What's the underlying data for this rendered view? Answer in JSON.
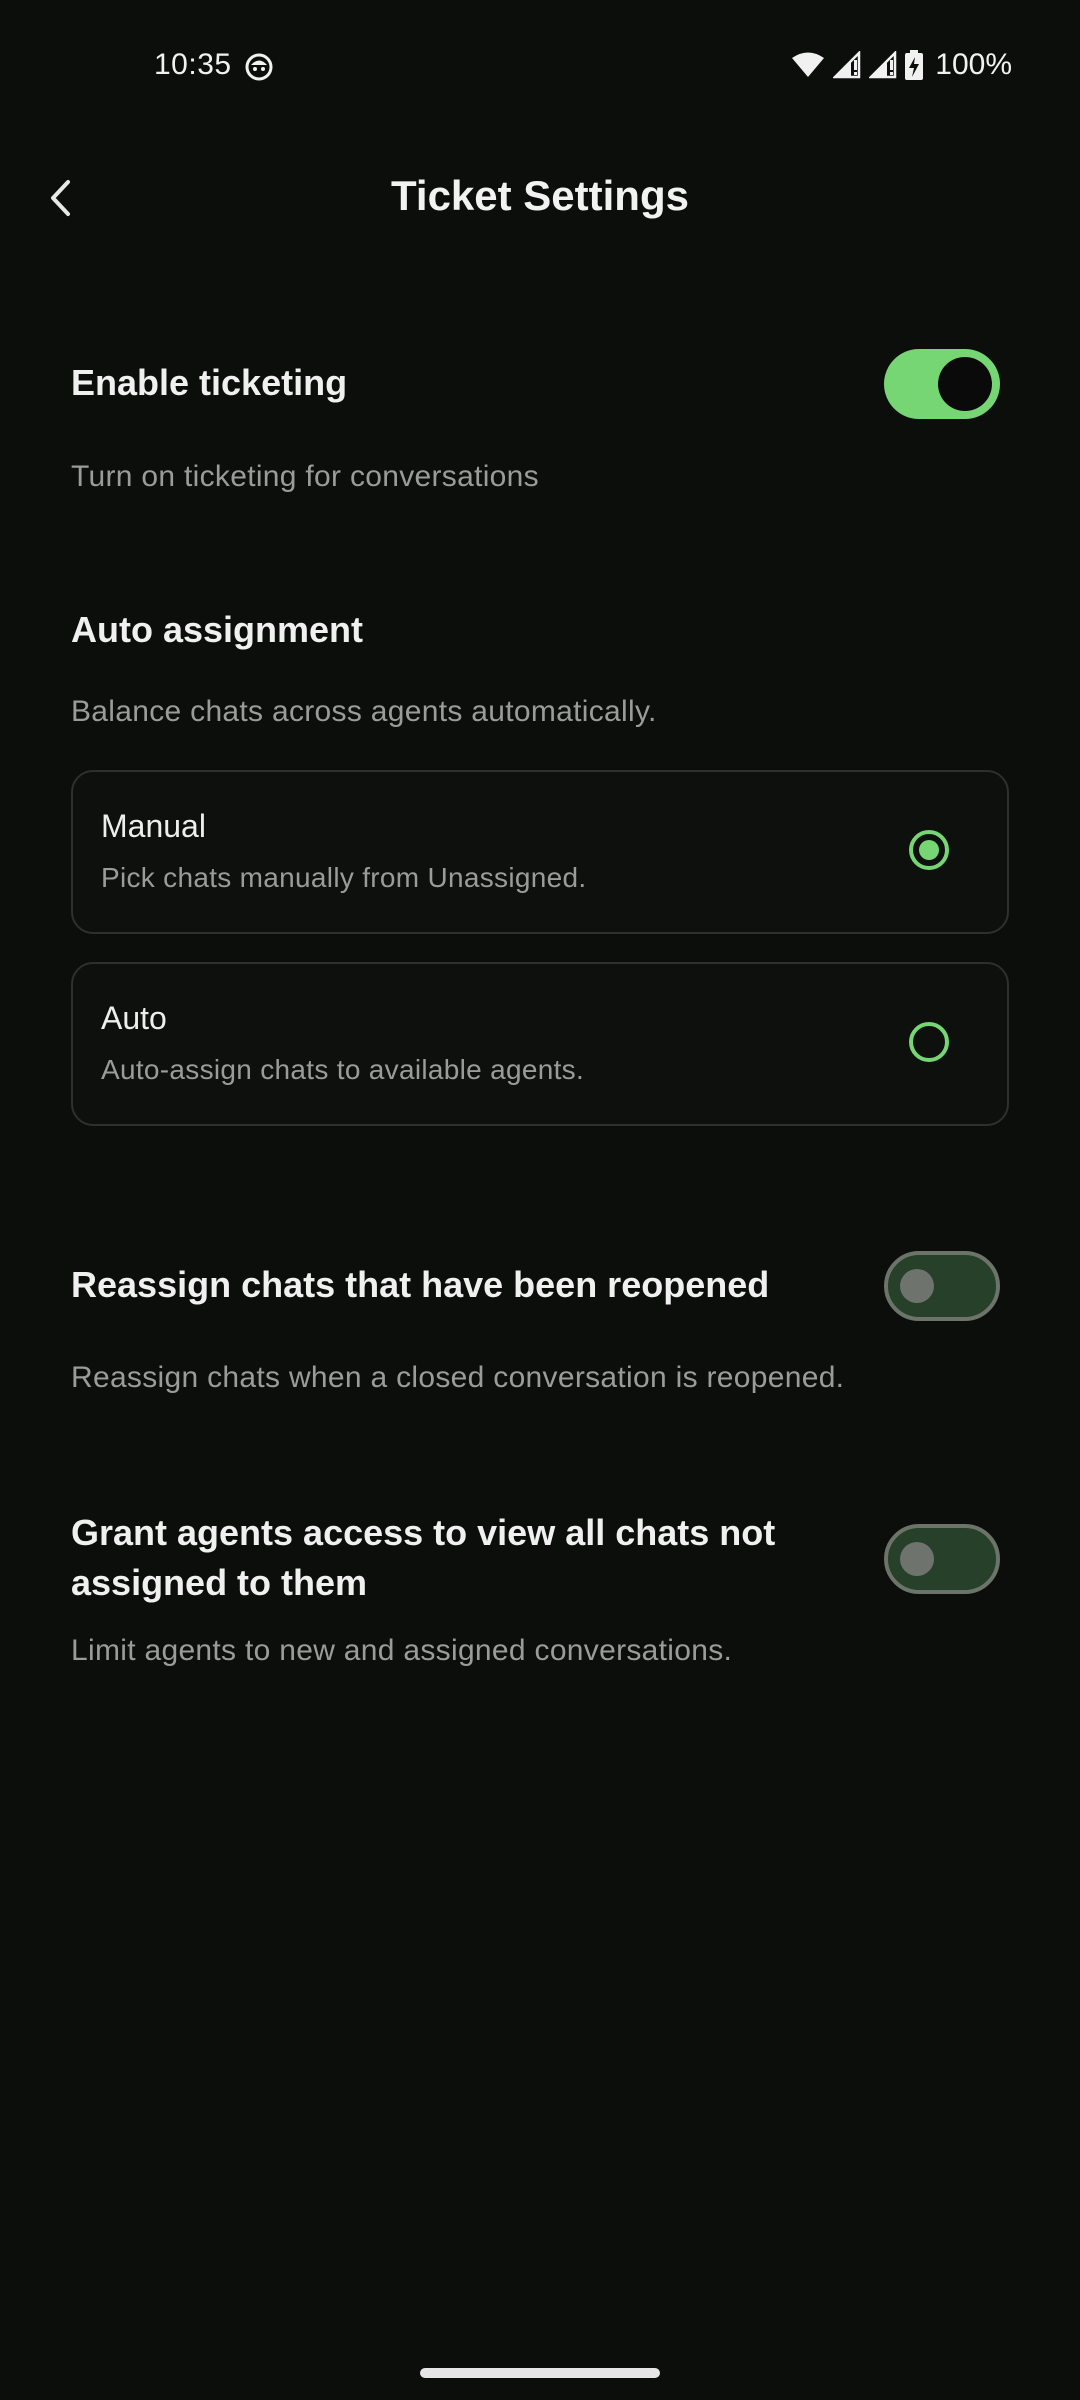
{
  "status_bar": {
    "time": "10:35",
    "battery": "100%",
    "icons": [
      "face-emoji-icon",
      "wifi-icon",
      "signal-icon",
      "signal-icon",
      "battery-charging-icon"
    ]
  },
  "header": {
    "title": "Ticket Settings",
    "back_icon": "chevron-left-icon"
  },
  "enable_ticketing": {
    "title": "Enable ticketing",
    "description": "Turn on ticketing for conversations",
    "enabled": true
  },
  "auto_assignment": {
    "title": "Auto assignment",
    "description": "Balance chats across agents automatically.",
    "options": [
      {
        "title": "Manual",
        "description": "Pick chats manually from Unassigned.",
        "selected": true
      },
      {
        "title": "Auto",
        "description": "Auto-assign chats to available agents.",
        "selected": false
      }
    ]
  },
  "reassign": {
    "title": "Reassign chats that have been reopened",
    "description": "Reassign chats when a closed conversation is reopened.",
    "enabled": false
  },
  "grant_access": {
    "title_line1": "Grant agents access to view all chats not",
    "title_line2": "assigned to them",
    "description": "Limit agents to new and assigned conversations.",
    "enabled": false
  },
  "colors": {
    "accent": "#76d673",
    "background": "#0c0e0c",
    "toggle_off_track": "#26402a",
    "muted_text": "#9a9c99"
  }
}
